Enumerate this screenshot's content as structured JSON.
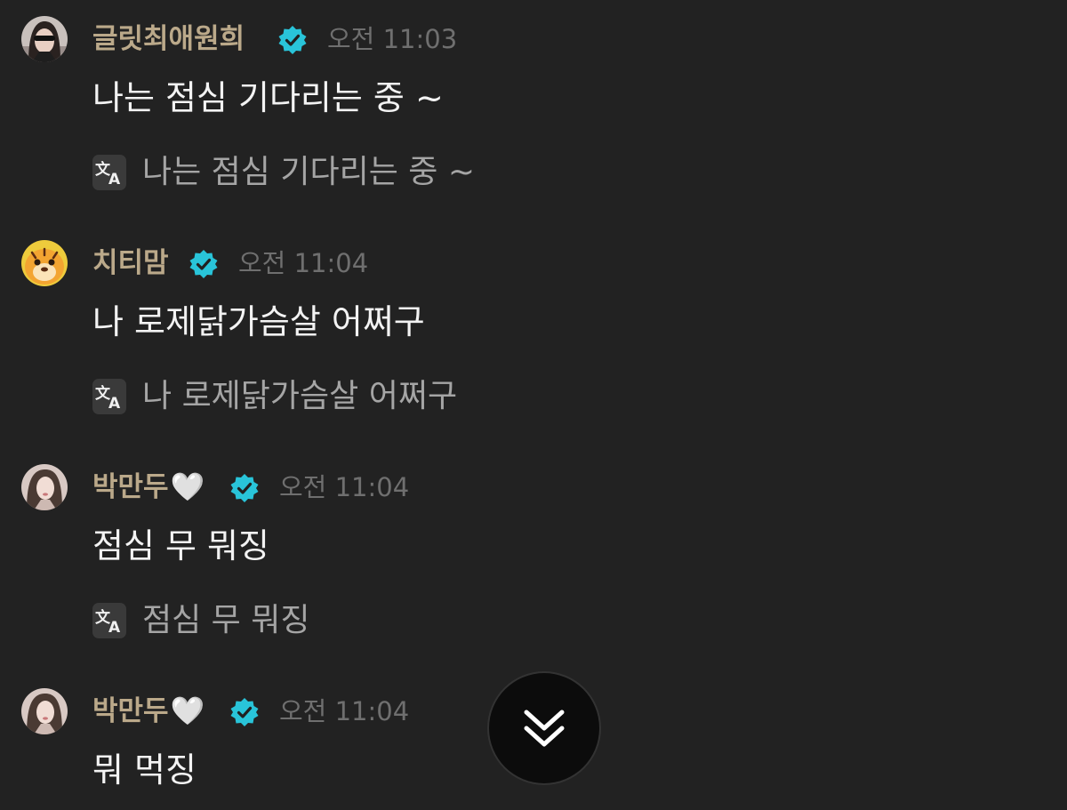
{
  "messages": [
    {
      "author": "글릿최애원희",
      "heart": "",
      "time": "오전 11:03",
      "text": "나는 점심 기다리는 중 ~",
      "translation": "나는 점심 기다리는 중 ~"
    },
    {
      "author": "치티맘",
      "heart": "",
      "time": "오전 11:04",
      "text": "나 로제닭가슴살 어쩌구",
      "translation": "나 로제닭가슴살 어쩌구"
    },
    {
      "author": "박만두",
      "heart": "🤍",
      "time": "오전 11:04",
      "text": "점심 무 뭐징",
      "translation": "점심 무 뭐징"
    },
    {
      "author": "박만두",
      "heart": "🤍",
      "time": "오전 11:04",
      "text": "뭐 먹징"
    }
  ],
  "icons": {
    "verified": "verified-badge-icon",
    "translate": "translate-icon",
    "scroll": "double-chevron-down-icon"
  },
  "colors": {
    "background": "#222222",
    "author": "#bba98a",
    "verified": "#29c4d9",
    "time": "#6f6f6f",
    "message": "#f3f3f3",
    "translation": "#a5a5a5"
  }
}
